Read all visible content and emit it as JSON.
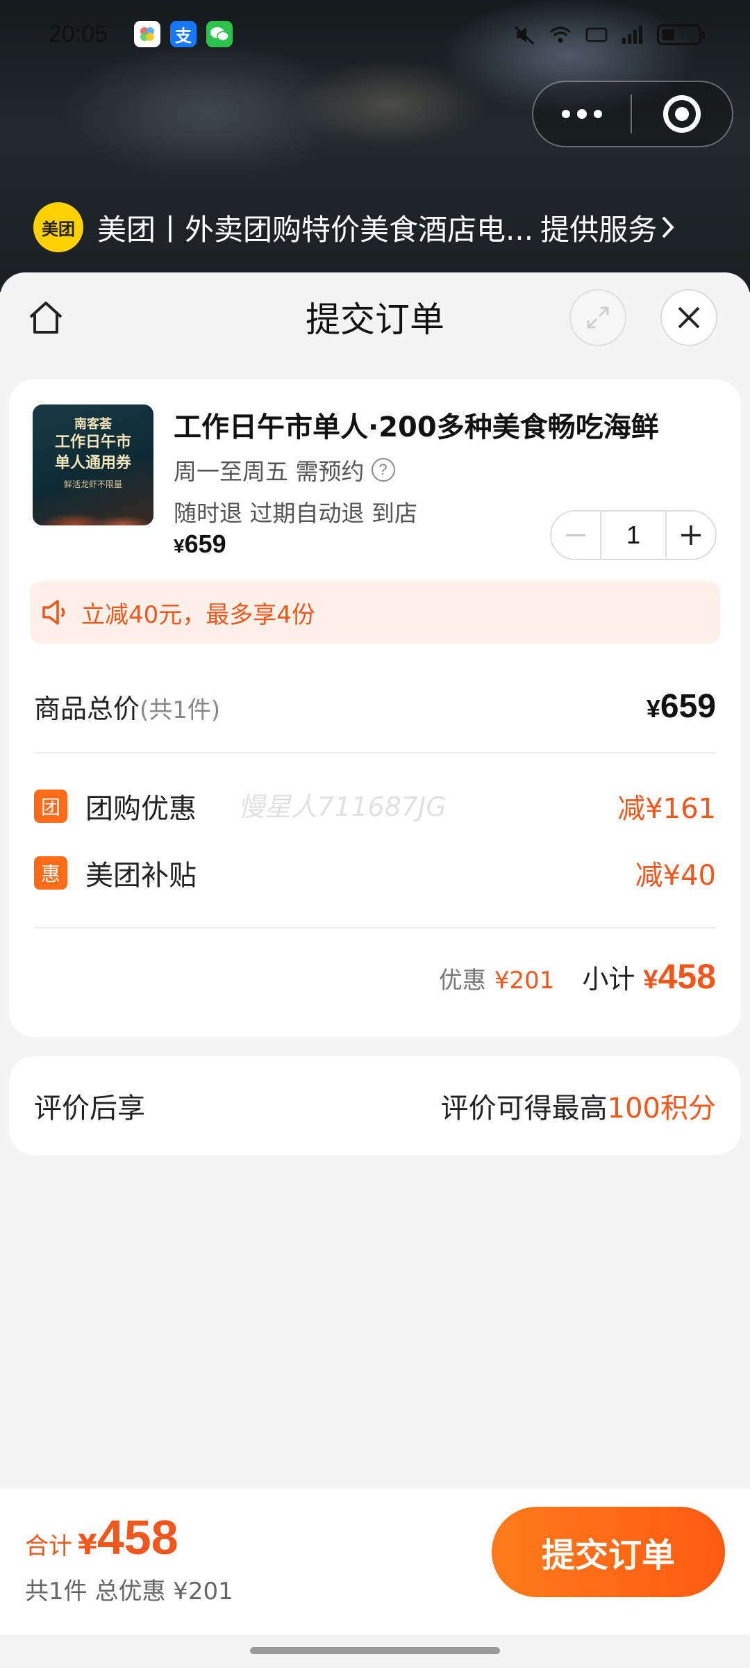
{
  "status_bar": {
    "time": "20:05",
    "apps": [
      "photos-app-icon",
      "alipay-app-icon",
      "wechat-app-icon"
    ],
    "alipay_glyph": "支"
  },
  "provider": {
    "logo_text": "美团",
    "name": "美团丨外卖团购特价美食酒店电...",
    "service_label": "提供服务"
  },
  "nav": {
    "title": "提交订单"
  },
  "product": {
    "thumb_brand": "南客荟",
    "thumb_line1": "工作日午市",
    "thumb_line2": "单人通用券",
    "thumb_sub": "鲜活龙虾不限量",
    "title": "工作日午市单人·200多种美食畅吃海鲜",
    "schedule": "周一至周五 需预约",
    "policy": "随时退 过期自动退 到店",
    "price_symbol": "¥",
    "price": "659",
    "quantity": "1"
  },
  "promo": {
    "text": "立减40元，最多享4份"
  },
  "summary": {
    "total_label": "商品总价",
    "total_count": "(共1件)",
    "total_symbol": "¥",
    "total_value": "659",
    "watermark": "慢星人711687JG",
    "discounts": [
      {
        "tag": "团",
        "label": "团购优惠",
        "value": "减¥161"
      },
      {
        "tag": "惠",
        "label": "美团补贴",
        "value": "减¥40"
      }
    ],
    "discount_label": "优惠",
    "discount_value": "¥201",
    "subtotal_label": "小计",
    "subtotal_symbol": "¥",
    "subtotal_value": "458"
  },
  "review": {
    "label": "评价后享",
    "text": "评价可得最高",
    "points": "100积分"
  },
  "bottom": {
    "total_label": "合计",
    "total_symbol": "¥",
    "total_value": "458",
    "sub": "共1件 总优惠 ¥201",
    "submit_label": "提交订单"
  },
  "colors": {
    "accent": "#f0571d",
    "button": "#ff6a17",
    "logo_yellow": "#ffd100"
  }
}
